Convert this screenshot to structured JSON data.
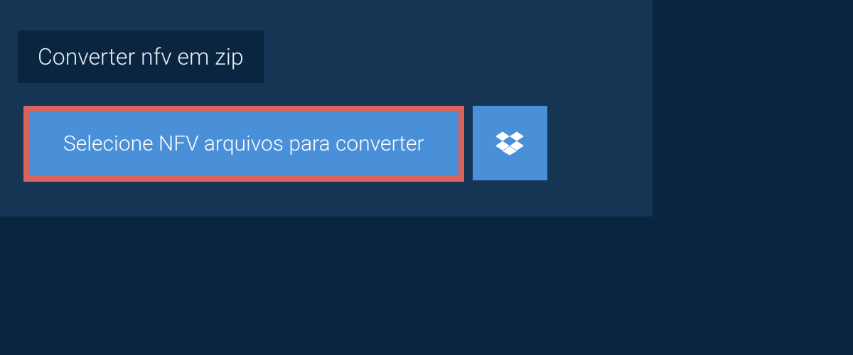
{
  "tab": {
    "title": "Converter nfv em zip"
  },
  "buttons": {
    "select_files_label": "Selecione NFV arquivos para converter"
  },
  "colors": {
    "background_dark": "#0a2540",
    "panel": "#163453",
    "button_primary": "#4a90d9",
    "highlight_border": "#d96459"
  }
}
